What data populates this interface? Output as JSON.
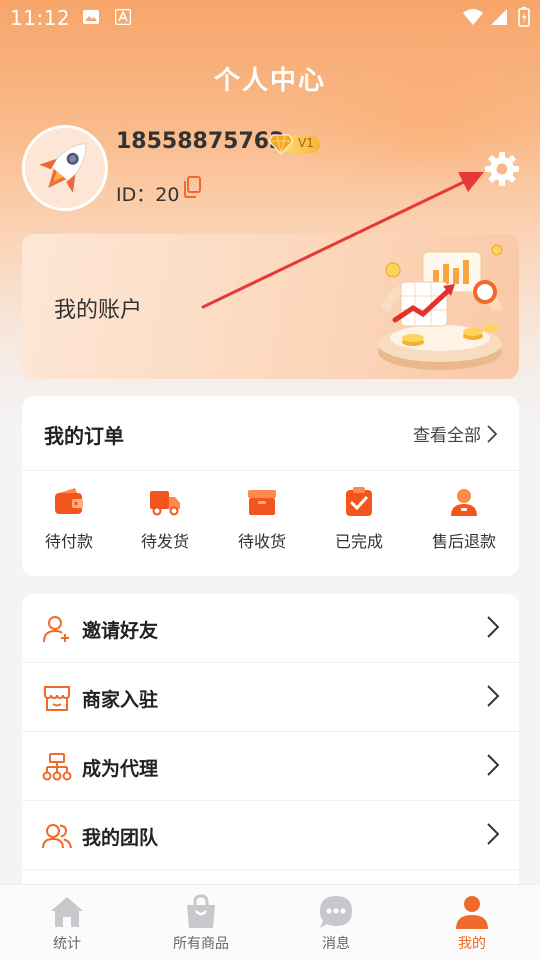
{
  "status_bar": {
    "time": "11:12"
  },
  "header": {
    "title": "个人中心"
  },
  "profile": {
    "phone": "18558875763",
    "vip_level": "V1",
    "id_text": "ID：20"
  },
  "account": {
    "label": "我的账户"
  },
  "orders": {
    "title": "我的订单",
    "view_all": "查看全部",
    "items": [
      {
        "label": "待付款",
        "icon": "wallet-icon"
      },
      {
        "label": "待发货",
        "icon": "truck-icon"
      },
      {
        "label": "待收货",
        "icon": "box-icon"
      },
      {
        "label": "已完成",
        "icon": "checklist-icon"
      },
      {
        "label": "售后退款",
        "icon": "service-icon"
      }
    ]
  },
  "menu": [
    {
      "label": "邀请好友",
      "icon": "user-add-icon"
    },
    {
      "label": "商家入驻",
      "icon": "store-icon"
    },
    {
      "label": "成为代理",
      "icon": "hierarchy-icon"
    },
    {
      "label": "我的团队",
      "icon": "team-icon"
    }
  ],
  "tabbar": [
    {
      "label": "统计",
      "icon": "home-icon",
      "active": false
    },
    {
      "label": "所有商品",
      "icon": "bag-icon",
      "active": false
    },
    {
      "label": "消息",
      "icon": "message-icon",
      "active": false
    },
    {
      "label": "我的",
      "icon": "person-icon",
      "active": true
    }
  ],
  "colors": {
    "accent": "#f06a2b",
    "header_bg": "#f7a56a",
    "arrow": "#e53935"
  }
}
